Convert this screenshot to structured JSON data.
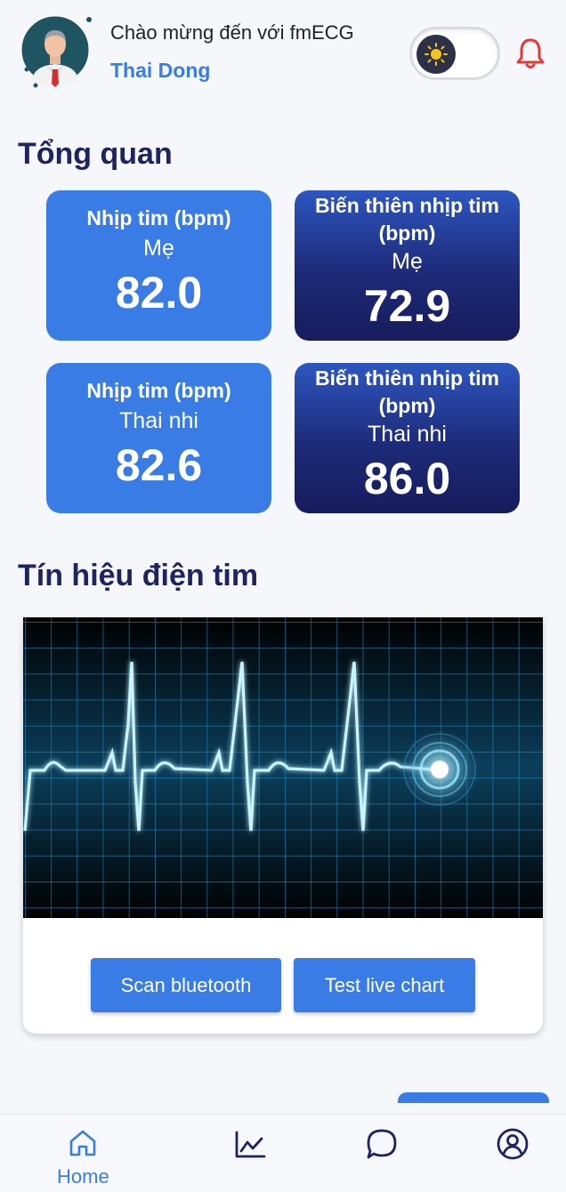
{
  "header": {
    "welcome_text": "Chào mừng đến với fmECG",
    "user_name": "Thai Dong"
  },
  "overview": {
    "title": "Tổng quan",
    "cards": [
      {
        "title": "Nhịp tim (bpm)",
        "subject": "Mẹ",
        "value": "82.0",
        "style": "light"
      },
      {
        "title": "Biến thiên nhịp tim (bpm)",
        "subject": "Mẹ",
        "value": "72.9",
        "style": "dark"
      },
      {
        "title": "Nhịp tim (bpm)",
        "subject": "Thai nhi",
        "value": "82.6",
        "style": "light"
      },
      {
        "title": "Biến thiên nhịp tim (bpm)",
        "subject": "Thai nhi",
        "value": "86.0",
        "style": "dark"
      }
    ]
  },
  "ecg": {
    "title": "Tín hiệu điện tim",
    "scan_button": "Scan bluetooth",
    "test_button": "Test live chart"
  },
  "bottom_nav": {
    "home_label": "Home",
    "active": "home"
  },
  "icons": {
    "theme_toggle": "sun-icon",
    "notifications": "bell-icon",
    "home": "home-icon",
    "chart": "line-chart-icon",
    "chat": "chat-bubble-icon",
    "profile": "user-circle-icon"
  },
  "colors": {
    "accent": "#3a7ce6",
    "heading": "#1e2460",
    "alert": "#e53935",
    "card_dark": "#1d2a78"
  }
}
